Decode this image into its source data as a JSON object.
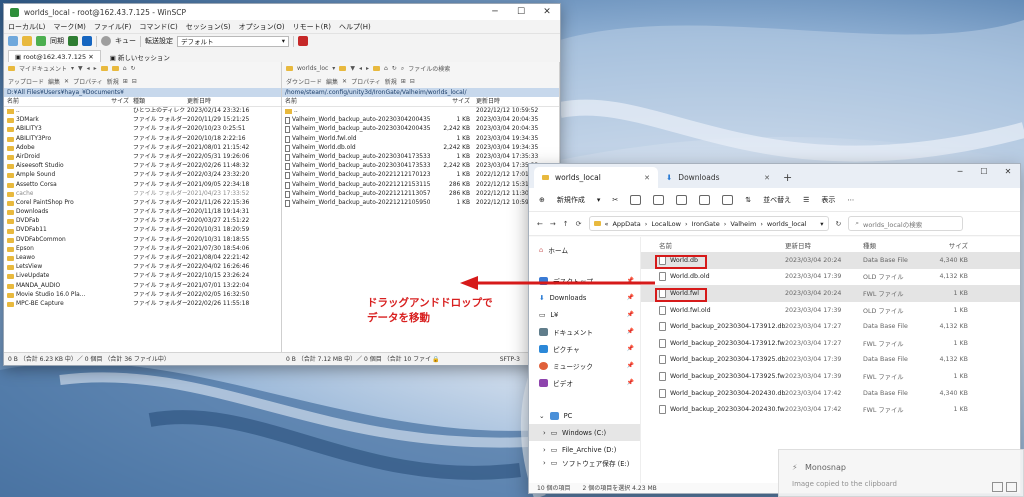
{
  "winscp": {
    "title": "worlds_local - root@162.43.7.125 - WinSCP",
    "menu": [
      "ローカル(L)",
      "マーク(M)",
      "ファイル(F)",
      "コマンド(C)",
      "セッション(S)",
      "オプション(O)",
      "リモート(R)",
      "ヘルプ(H)"
    ],
    "toolbar": {
      "sync": "同期",
      "queue": "キュー",
      "transfer_label": "転送設定",
      "transfer_value": "デフォルト"
    },
    "tabs": {
      "session": "root@162.43.7.125",
      "new_session": "新しいセッション"
    },
    "left": {
      "bar1": "マイドキュメント",
      "bar2": [
        "アップロード",
        "編集",
        "プロパティ",
        "新規"
      ],
      "path": "D:¥All Files¥Users¥haya_¥Documents¥",
      "headers": {
        "name": "名前",
        "size": "サイズ",
        "type": "種類",
        "date": "更新日時"
      },
      "rows": [
        {
          "name": "..",
          "type": "ひとつ上のディレクトリ",
          "date": "2023/02/14 23:32:16",
          "kind": "up"
        },
        {
          "name": "3DMark",
          "type": "ファイル フォルダー",
          "date": "2020/11/29 15:21:25",
          "kind": "folder"
        },
        {
          "name": "ABILITY3",
          "type": "ファイル フォルダー",
          "date": "2020/10/23 0:25:51",
          "kind": "folder"
        },
        {
          "name": "ABILITY3Pro",
          "type": "ファイル フォルダー",
          "date": "2020/10/18 2:22:16",
          "kind": "folder"
        },
        {
          "name": "Adobe",
          "type": "ファイル フォルダー",
          "date": "2021/08/01 21:15:42",
          "kind": "folder"
        },
        {
          "name": "AirDroid",
          "type": "ファイル フォルダー",
          "date": "2022/05/31 19:26:06",
          "kind": "folder"
        },
        {
          "name": "Aiseesoft Studio",
          "type": "ファイル フォルダー",
          "date": "2022/02/26 11:48:32",
          "kind": "folder"
        },
        {
          "name": "Ample Sound",
          "type": "ファイル フォルダー",
          "date": "2022/03/24 23:32:20",
          "kind": "folder"
        },
        {
          "name": "Assetto Corsa",
          "type": "ファイル フォルダー",
          "date": "2021/09/05 22:34:18",
          "kind": "folder"
        },
        {
          "name": "cache",
          "type": "ファイル フォルダー",
          "date": "2021/04/23 17:33:52",
          "kind": "folder",
          "dim": true
        },
        {
          "name": "Corel PaintShop Pro",
          "type": "ファイル フォルダー",
          "date": "2021/11/26 22:15:36",
          "kind": "folder"
        },
        {
          "name": "Downloads",
          "type": "ファイル フォルダー",
          "date": "2020/11/18 19:14:31",
          "kind": "folder"
        },
        {
          "name": "DVDFab",
          "type": "ファイル フォルダー",
          "date": "2020/03/27 21:51:22",
          "kind": "folder"
        },
        {
          "name": "DVDFab11",
          "type": "ファイル フォルダー",
          "date": "2020/10/31 18:20:59",
          "kind": "folder"
        },
        {
          "name": "DVDFabCommon",
          "type": "ファイル フォルダー",
          "date": "2020/10/31 18:18:55",
          "kind": "folder"
        },
        {
          "name": "Epson",
          "type": "ファイル フォルダー",
          "date": "2021/07/30 18:54:06",
          "kind": "folder"
        },
        {
          "name": "Leawo",
          "type": "ファイル フォルダー",
          "date": "2021/08/04 22:21:42",
          "kind": "folder"
        },
        {
          "name": "LetsView",
          "type": "ファイル フォルダー",
          "date": "2022/04/02 16:26:46",
          "kind": "folder"
        },
        {
          "name": "LiveUpdate",
          "type": "ファイル フォルダー",
          "date": "2022/10/15 23:26:24",
          "kind": "folder"
        },
        {
          "name": "MANDA_AUDIO",
          "type": "ファイル フォルダー",
          "date": "2021/07/01 13:22:04",
          "kind": "folder"
        },
        {
          "name": "Movie Studio 16.0 Pla...",
          "type": "ファイル フォルダー",
          "date": "2022/02/05 16:32:50",
          "kind": "folder"
        },
        {
          "name": "MPC-BE Capture",
          "type": "ファイル フォルダー",
          "date": "2022/02/26 11:55:18",
          "kind": "folder"
        }
      ],
      "status": "0 B （合計 6.23 KB 中）／ 0 個目 （合計 36 ファイル中）"
    },
    "right": {
      "bar1": "worlds_loc",
      "search": "ファイルの検索",
      "bar2": [
        "ダウンロード",
        "編集",
        "プロパティ",
        "新規"
      ],
      "path": "/home/steam/.config/unity3d/IronGate/Valheim/worlds_local/",
      "headers": {
        "name": "名前",
        "size": "サイズ",
        "date": "更新日時"
      },
      "rows": [
        {
          "name": "..",
          "size": "",
          "date": "2022/12/12 10:59:52",
          "kind": "up"
        },
        {
          "name": "Valheim_World_backup_auto-20230304200435.fwl",
          "size": "1 KB",
          "date": "2023/03/04 20:04:35",
          "kind": "file"
        },
        {
          "name": "Valheim_World_backup_auto-20230304200435.db",
          "size": "2,242 KB",
          "date": "2023/03/04 20:04:35",
          "kind": "file"
        },
        {
          "name": "Valheim_World.fwl.old",
          "size": "1 KB",
          "date": "2023/03/04 19:34:35",
          "kind": "file"
        },
        {
          "name": "Valheim_World.db.old",
          "size": "2,242 KB",
          "date": "2023/03/04 19:34:35",
          "kind": "file"
        },
        {
          "name": "Valheim_World_backup_auto-20230304173533.fwl",
          "size": "1 KB",
          "date": "2023/03/04 17:35:33",
          "kind": "file"
        },
        {
          "name": "Valheim_World_backup_auto-20230304173533.db",
          "size": "2,242 KB",
          "date": "2023/03/04 17:35:33",
          "kind": "file"
        },
        {
          "name": "Valheim_World_backup_auto-20221212170123.fwl",
          "size": "1 KB",
          "date": "2022/12/12 17:01:23",
          "kind": "file"
        },
        {
          "name": "Valheim_World_backup_auto-20221212153115.db",
          "size": "286 KB",
          "date": "2022/12/12 15:31:15",
          "kind": "file"
        },
        {
          "name": "Valheim_World_backup_auto-20221212113057.db",
          "size": "286 KB",
          "date": "2022/12/12 11:30:57",
          "kind": "file"
        },
        {
          "name": "Valheim_World_backup_auto-20221212105950.fwl",
          "size": "1 KB",
          "date": "2022/12/12 10:59:50",
          "kind": "file"
        }
      ],
      "status": "0 B （合計 7.12 MB 中）／ 0 個目 （合計 10 ファイル中）",
      "protocol": "SFTP-3"
    }
  },
  "explorer": {
    "tab_active": "worlds_local",
    "tab_inactive": "Downloads",
    "cmd": {
      "new": "新規作成",
      "sort": "並べ替え",
      "view": "表示"
    },
    "breadcrumb": [
      "AppData",
      "LocalLow",
      "IronGate",
      "Valheim",
      "worlds_local"
    ],
    "search_placeholder": "worlds_localの検索",
    "nav": {
      "home": "ホーム",
      "desktop": "デスクトップ",
      "downloads": "Downloads",
      "docs": "ドキュメント",
      "pictures": "ピクチャ",
      "music": "ミュージック",
      "videos": "ビデオ",
      "l": "L¥",
      "pc": "PC",
      "drive_c": "Windows (C:)",
      "drive_d": "File_Archive (D:)",
      "drive_e": "ソフトウェア保存 (E:)"
    },
    "headers": {
      "name": "名前",
      "date": "更新日時",
      "type": "種類",
      "size": "サイズ"
    },
    "rows": [
      {
        "name": "World.db",
        "date": "2023/03/04 20:24",
        "type": "Data Base File",
        "size": "4,340 KB",
        "hl": true
      },
      {
        "name": "World.db.old",
        "date": "2023/03/04 17:39",
        "type": "OLD ファイル",
        "size": "4,132 KB"
      },
      {
        "name": "World.fwl",
        "date": "2023/03/04 20:24",
        "type": "FWL ファイル",
        "size": "1 KB",
        "hl": true
      },
      {
        "name": "World.fwl.old",
        "date": "2023/03/04 17:39",
        "type": "OLD ファイル",
        "size": "1 KB"
      },
      {
        "name": "World_backup_20230304-173912.db",
        "date": "2023/03/04 17:27",
        "type": "Data Base File",
        "size": "4,132 KB"
      },
      {
        "name": "World_backup_20230304-173912.fwl",
        "date": "2023/03/04 17:27",
        "type": "FWL ファイル",
        "size": "1 KB"
      },
      {
        "name": "World_backup_20230304-173925.db",
        "date": "2023/03/04 17:39",
        "type": "Data Base File",
        "size": "4,132 KB"
      },
      {
        "name": "World_backup_20230304-173925.fwl",
        "date": "2023/03/04 17:39",
        "type": "FWL ファイル",
        "size": "1 KB"
      },
      {
        "name": "World_backup_20230304-202430.db",
        "date": "2023/03/04 17:42",
        "type": "Data Base File",
        "size": "4,340 KB"
      },
      {
        "name": "World_backup_20230304-202430.fwl",
        "date": "2023/03/04 17:42",
        "type": "FWL ファイル",
        "size": "1 KB"
      }
    ],
    "status": "10 個の項目　　2 個の項目を選択 4.23 MB"
  },
  "annotation": {
    "line1": "ドラッグアンドドロップで",
    "line2": "データを移動"
  },
  "toast": {
    "title": "Monosnap",
    "body": "Image copied to the clipboard"
  },
  "colors": {
    "annotation_red": "#d61a1a",
    "folder": "#e8b93e",
    "path_bar": "#c7d8ec"
  }
}
